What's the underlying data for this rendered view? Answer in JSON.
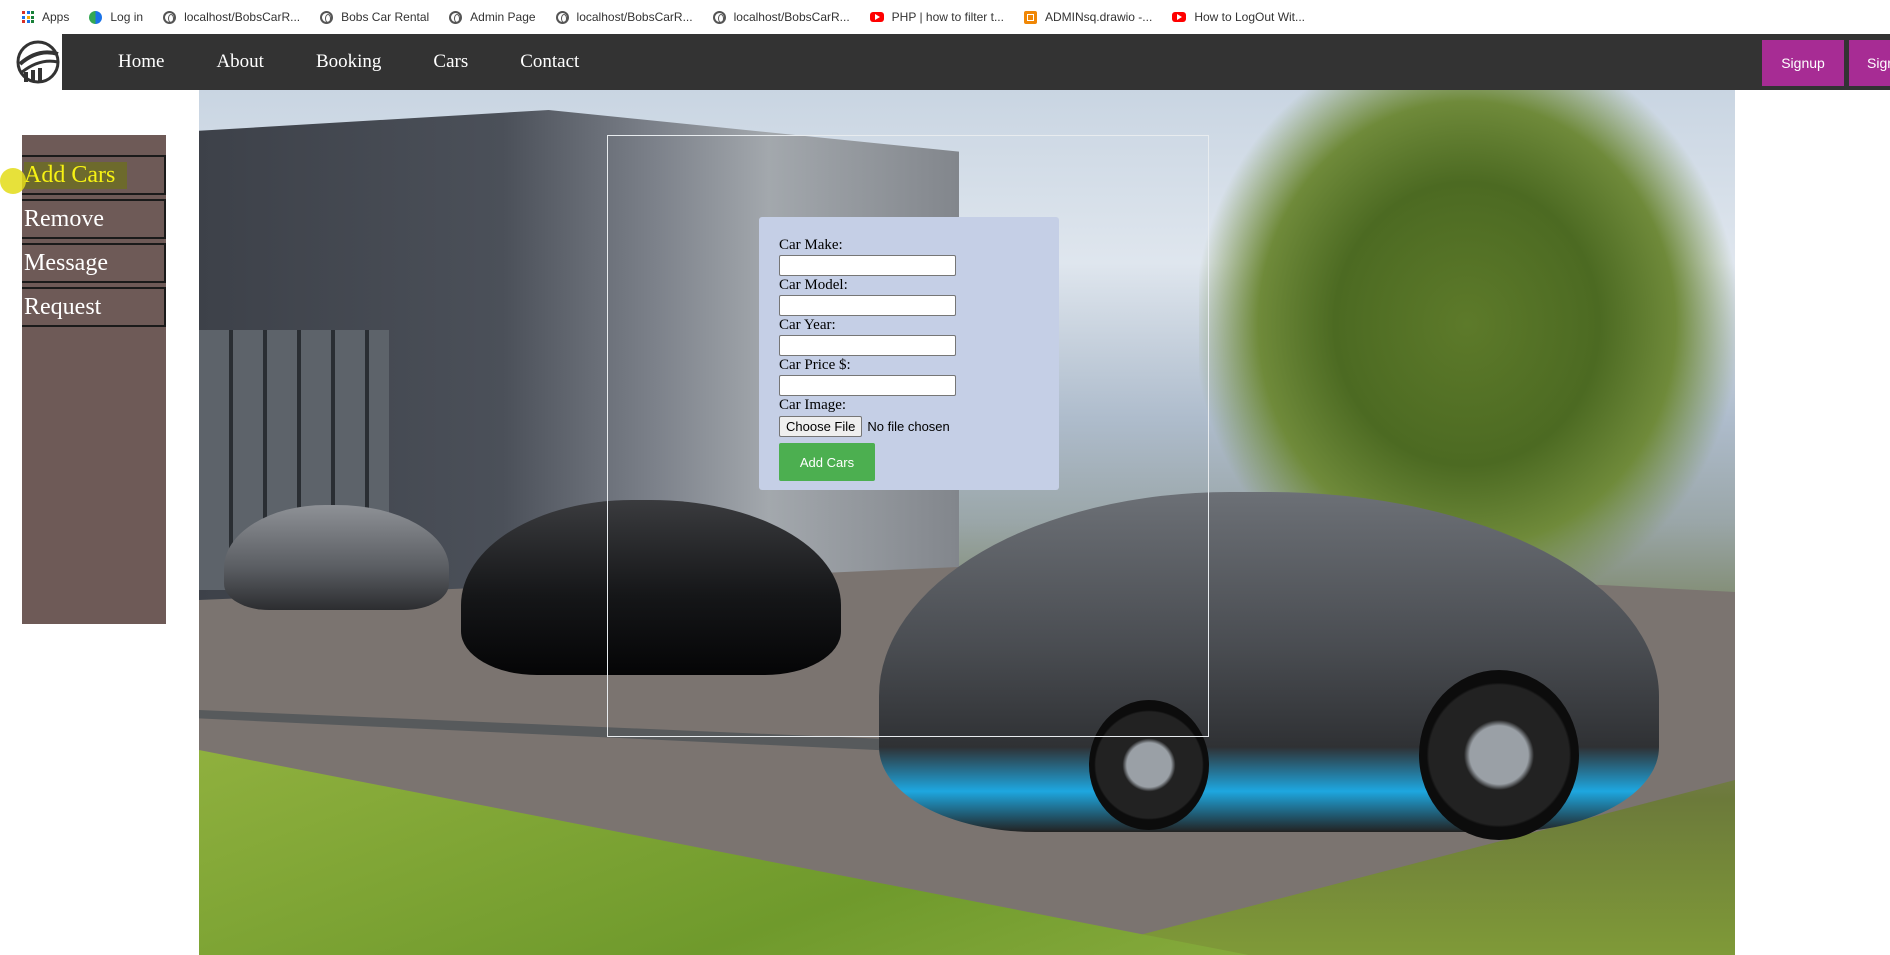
{
  "bookmarks": [
    {
      "label": "Apps",
      "icon": "apps-grid-icon"
    },
    {
      "label": "Log in",
      "icon": "login-favicon-icon"
    },
    {
      "label": "localhost/BobsCarR...",
      "icon": "globe-icon"
    },
    {
      "label": "Bobs Car Rental",
      "icon": "globe-icon"
    },
    {
      "label": "Admin Page",
      "icon": "globe-icon"
    },
    {
      "label": "localhost/BobsCarR...",
      "icon": "globe-icon"
    },
    {
      "label": "localhost/BobsCarR...",
      "icon": "globe-icon"
    },
    {
      "label": "PHP | how to filter t...",
      "icon": "youtube-icon"
    },
    {
      "label": "ADMINsq.drawio -...",
      "icon": "drawio-icon"
    },
    {
      "label": "How to LogOut Wit...",
      "icon": "youtube-icon"
    }
  ],
  "nav": {
    "links": [
      "Home",
      "About",
      "Booking",
      "Cars",
      "Contact"
    ],
    "signup_label": "Signup",
    "signin_label": "Sign"
  },
  "sidebar": {
    "items": [
      {
        "label": "Add Cars",
        "active": true
      },
      {
        "label": "Remove",
        "active": false
      },
      {
        "label": "Message",
        "active": false
      },
      {
        "label": "Request",
        "active": false
      }
    ]
  },
  "form": {
    "make_label": "Car Make:",
    "make_value": "",
    "model_label": "Car Model:",
    "model_value": "",
    "year_label": "Car Year:",
    "year_value": "",
    "price_label": "Car Price $:",
    "price_value": "",
    "image_label": "Car Image:",
    "file_button": "Choose File",
    "file_status": "No file chosen",
    "submit_label": "Add Cars"
  },
  "colors": {
    "navbar": "#333333",
    "auth_button": "#a72c94",
    "sidebar": "#6e5a57",
    "sidebar_active_text": "#f7f213",
    "form_card": "#c5cfe6",
    "submit_button": "#4caf50"
  }
}
